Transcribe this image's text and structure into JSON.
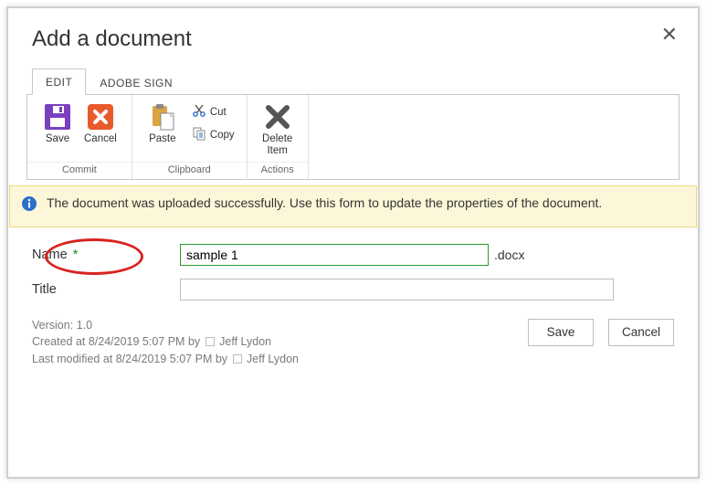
{
  "dialog": {
    "title": "Add a document",
    "close_tooltip": "Close"
  },
  "tabs": {
    "edit": "EDIT",
    "adobe": "ADOBE SIGN"
  },
  "ribbon": {
    "save": "Save",
    "cancel": "Cancel",
    "paste": "Paste",
    "cut": "Cut",
    "copy": "Copy",
    "delete_line1": "Delete",
    "delete_line2": "Item",
    "group_commit": "Commit",
    "group_clipboard": "Clipboard",
    "group_actions": "Actions"
  },
  "info": {
    "message": "The document was uploaded successfully. Use this form to update the properties of the document."
  },
  "form": {
    "name_label": "Name",
    "name_required": "*",
    "name_value": "sample 1",
    "name_ext": ".docx",
    "title_label": "Title",
    "title_value": ""
  },
  "meta": {
    "version": "Version: 1.0",
    "created_prefix": "Created at 8/24/2019 5:07 PM  by",
    "created_user": "Jeff Lydon",
    "modified_prefix": "Last modified at 8/24/2019 5:07 PM  by",
    "modified_user": "Jeff Lydon"
  },
  "buttons": {
    "save": "Save",
    "cancel": "Cancel"
  }
}
